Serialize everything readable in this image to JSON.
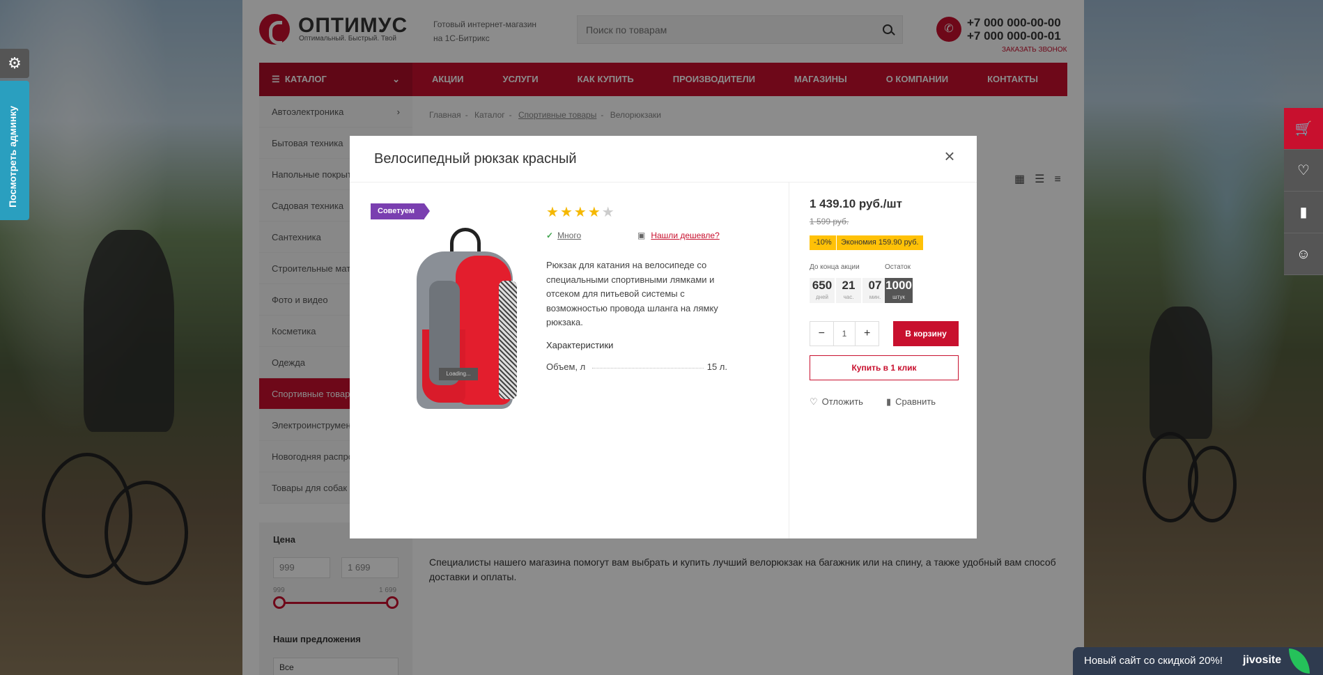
{
  "header": {
    "logo_name": "ОПТИМУС",
    "logo_slogan": "Оптимальный. Быстрый. Твой",
    "description_line1": "Готовый интернет-магазин",
    "description_line2": "на 1С-Битрикс",
    "search_placeholder": "Поиск по товарам",
    "phone1": "+7 000 000-00-00",
    "phone2": "+7 000 000-00-01",
    "callback": "ЗАКАЗАТЬ ЗВОНОК"
  },
  "nav": {
    "catalog": "КАТАЛОГ",
    "items": [
      "АКЦИИ",
      "УСЛУГИ",
      "КАК КУПИТЬ",
      "ПРОИЗВОДИТЕЛИ",
      "МАГАЗИНЫ",
      "О КОМПАНИИ",
      "КОНТАКТЫ"
    ]
  },
  "sidebar": {
    "items": [
      {
        "label": "Автоэлектроника"
      },
      {
        "label": "Бытовая техника"
      },
      {
        "label": "Напольные покрытия"
      },
      {
        "label": "Садовая техника"
      },
      {
        "label": "Сантехника"
      },
      {
        "label": "Строительные материалы"
      },
      {
        "label": "Фото и видео"
      },
      {
        "label": "Косметика"
      },
      {
        "label": "Одежда"
      },
      {
        "label": "Спортивные товары"
      },
      {
        "label": "Электроинструменты"
      },
      {
        "label": "Новогодняя распродажа"
      },
      {
        "label": "Товары для собак"
      }
    ]
  },
  "filter": {
    "price_title": "Цена",
    "price_min": "999",
    "price_max": "1 699",
    "range_min_label": "999",
    "range_max_label": "1 699",
    "offers_title": "Наши предложения",
    "offers_value": "Все"
  },
  "breadcrumbs": [
    "Главная",
    "Каталог",
    "Спортивные товары",
    "Велорюкзаки"
  ],
  "intro_text": "Специалисты нашего магазина помогут вам выбрать и купить лучший велорюкзак на багажник или на спину, а также удобный вам способ доставки и оплаты.",
  "admin_tab": "Посмотреть админку",
  "jivo": {
    "text": "Новый сайт со скидкой 20%!",
    "logo": "jivosite"
  },
  "modal": {
    "title": "Велосипедный рюкзак красный",
    "sticker": "Советуем",
    "image_loading": "Loading...",
    "rating": 4,
    "rating_max": 5,
    "stock": "Много",
    "cheaper": "Нашли дешевле?",
    "description": "Рюкзак для катания на велосипеде со специальными спортивными лямками и отсеком для питьевой системы с возможностью провода шланга на лямку рюкзака.",
    "characteristics_title": "Характеристики",
    "char_name": "Объем, л",
    "char_value": "15 л.",
    "price": "1 439.10 руб./шт",
    "old_price": "1 599 руб.",
    "discount": "-10%",
    "economy": "Экономия 159.90 руб.",
    "timer_label": "До конца акции",
    "stock_label": "Остаток",
    "timer": {
      "days": "650",
      "days_unit": "дней",
      "hours": "21",
      "hours_unit": "час.",
      "mins": "07",
      "mins_unit": "мин."
    },
    "remain": "1000",
    "remain_unit": "штук",
    "quantity": "1",
    "to_cart": "В корзину",
    "one_click": "Купить в 1 клик",
    "defer": "Отложить",
    "compare": "Сравнить"
  },
  "colors": {
    "brand": "#c8102e",
    "sticker": "#7a3fb0",
    "badge": "#ffc107",
    "admin": "#2a9fbf"
  }
}
